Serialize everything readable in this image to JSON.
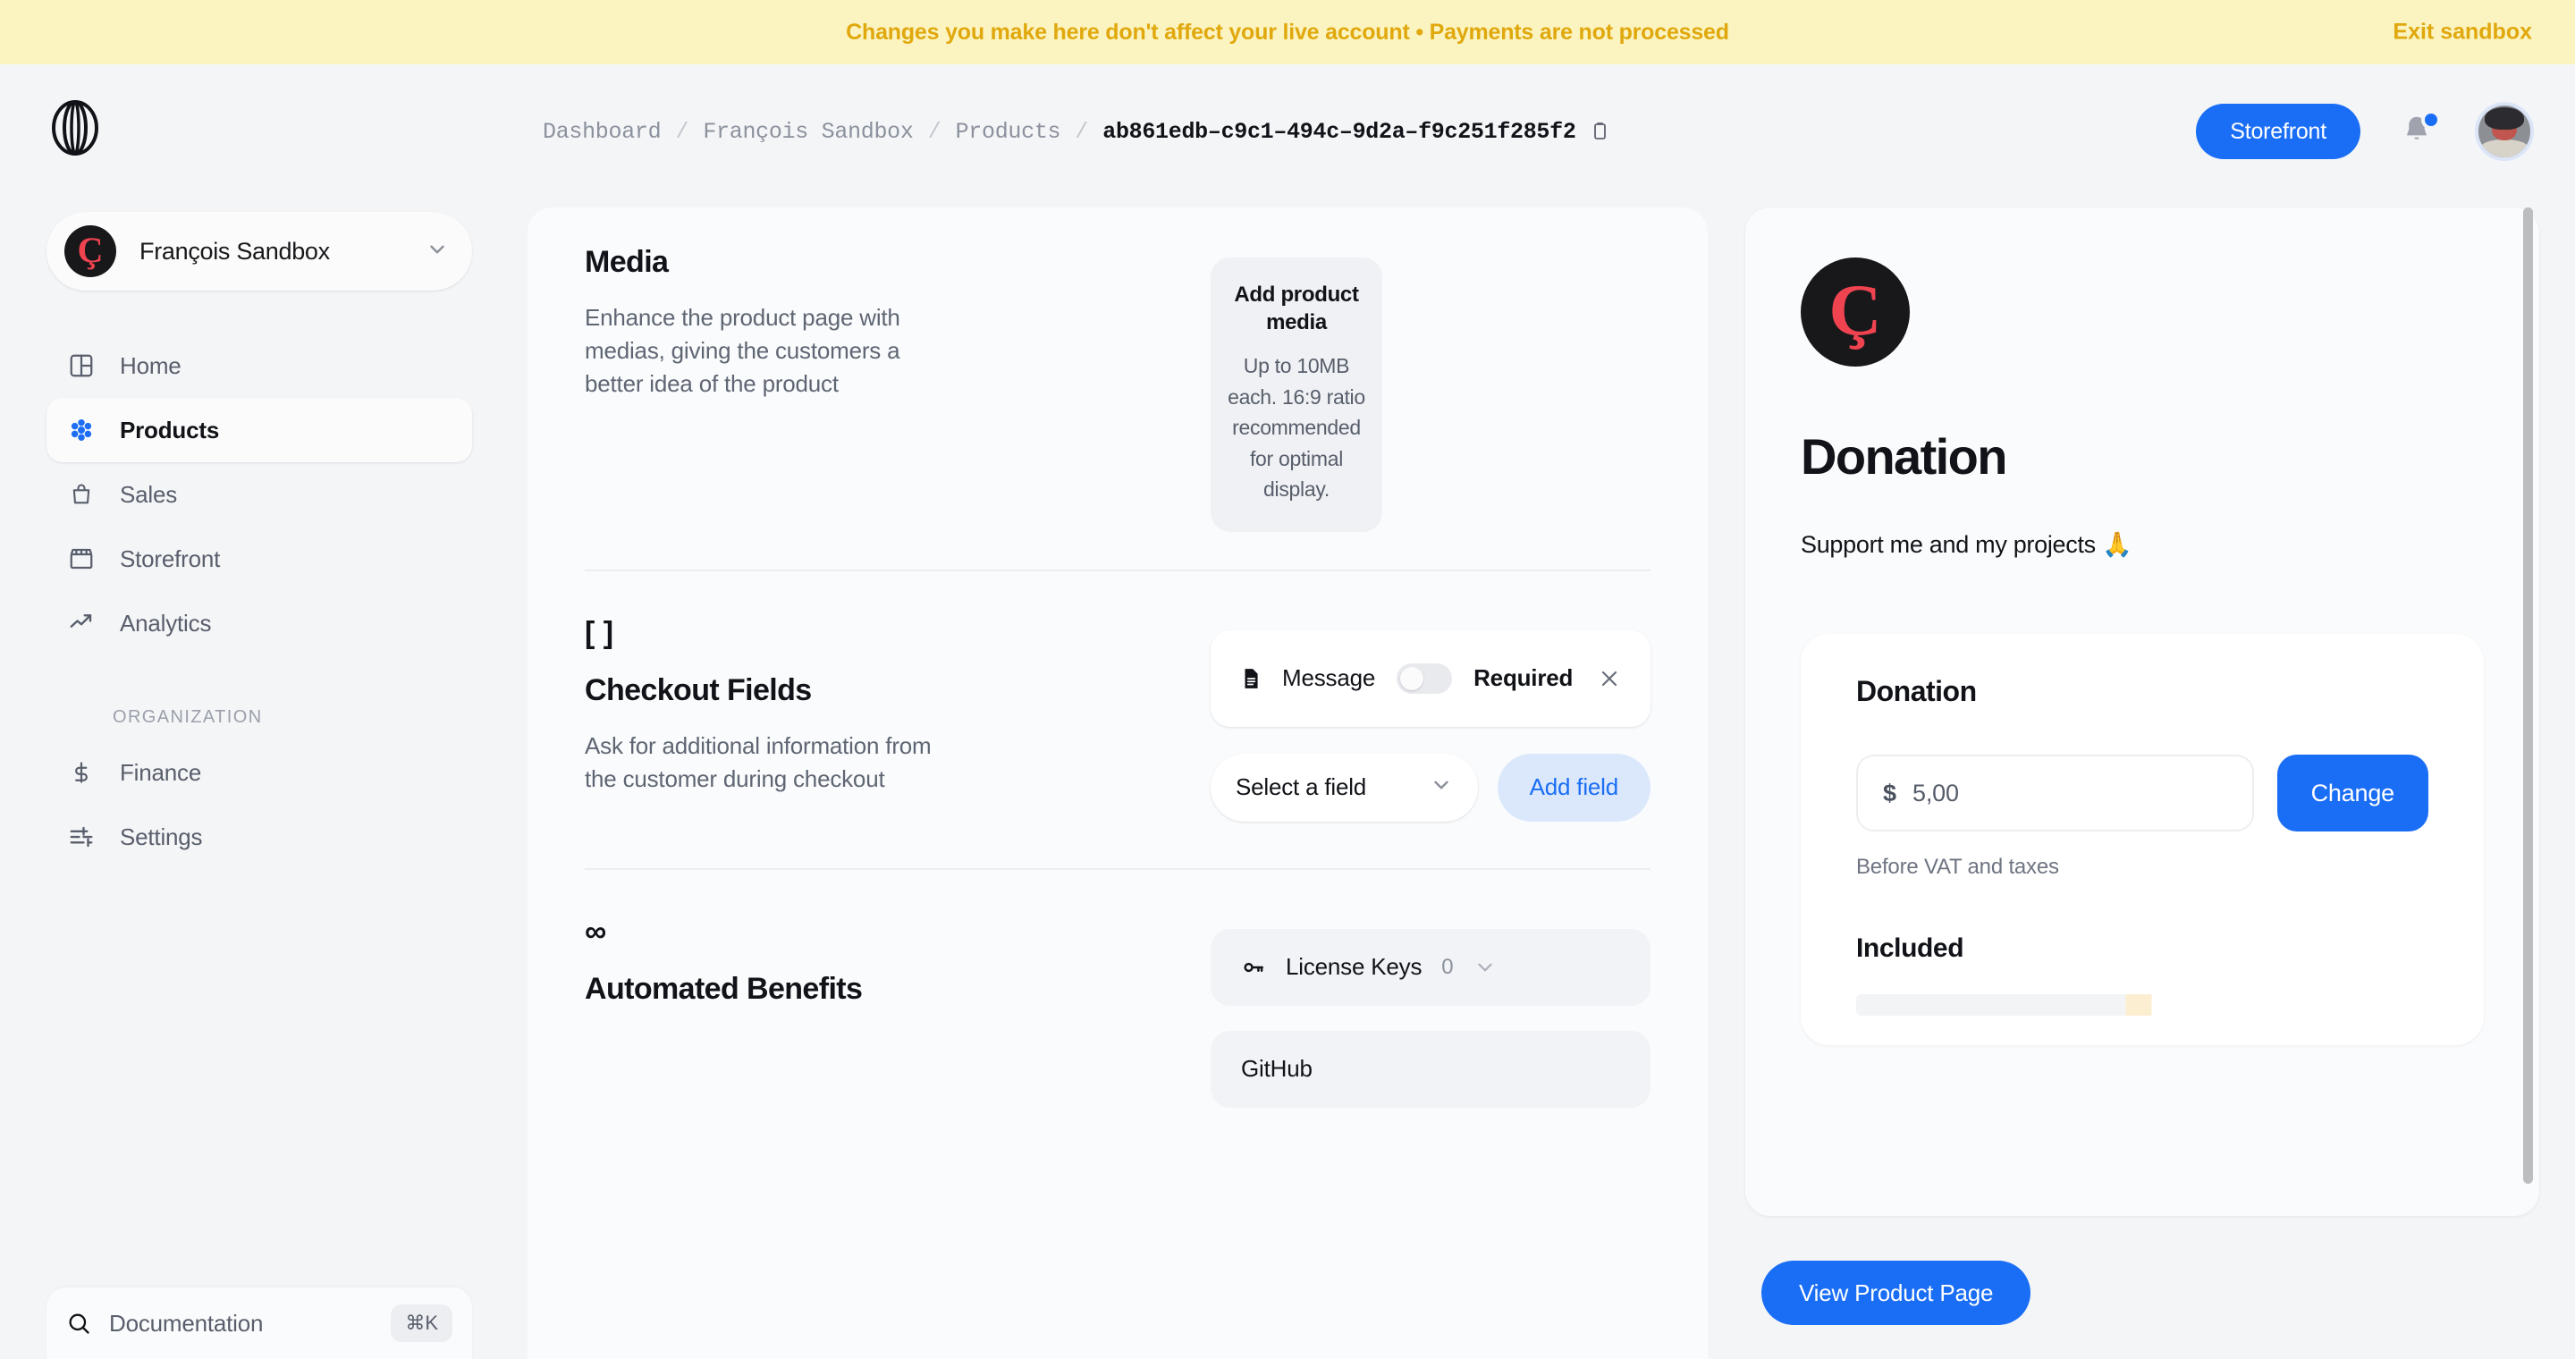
{
  "banner": {
    "message": "Changes you make here don't affect your live account • Payments are not processed",
    "exit_label": "Exit sandbox",
    "bg_color": "#fbf4c0",
    "text_color": "#e0a80d"
  },
  "sidebar": {
    "logo_name": "polar-logo",
    "org": {
      "name": "François Sandbox",
      "avatar_letter": "Ç"
    },
    "nav": [
      {
        "label": "Home",
        "icon": "layout-icon",
        "active": false
      },
      {
        "label": "Products",
        "icon": "flower-icon",
        "active": true
      },
      {
        "label": "Sales",
        "icon": "bag-icon",
        "active": false
      },
      {
        "label": "Storefront",
        "icon": "store-icon",
        "active": false
      },
      {
        "label": "Analytics",
        "icon": "trending-up-icon",
        "active": false
      }
    ],
    "group_label": "ORGANIZATION",
    "org_nav": [
      {
        "label": "Finance",
        "icon": "dollar-icon",
        "active": false
      },
      {
        "label": "Settings",
        "icon": "sliders-icon",
        "active": false
      }
    ],
    "documentation": {
      "label": "Documentation",
      "shortcut": "⌘K"
    }
  },
  "header": {
    "breadcrumb": [
      {
        "label": "Dashboard",
        "current": false
      },
      {
        "label": "François Sandbox",
        "current": false
      },
      {
        "label": "Products",
        "current": false
      },
      {
        "label": "ab861edb–c9c1–494c–9d2a–f9c251f285f2",
        "current": true
      }
    ],
    "separator": "/",
    "copy_icon": "clipboard-icon",
    "storefront_button": "Storefront",
    "notifications_icon": "bell-icon",
    "has_notification": true,
    "avatar_name": "user-avatar",
    "accent_color": "#1a6ef5"
  },
  "main": {
    "media": {
      "title": "Media",
      "description": "Enhance the product page with medias, giving the customers a better idea of the product",
      "dropzone_title": "Add product media",
      "dropzone_subtitle": "Up to 10MB each. 16:9 ratio recommended for optimal display."
    },
    "checkout_fields": {
      "icon_glyph": "[ ]",
      "title": "Checkout Fields",
      "description": "Ask for additional information from the customer during checkout",
      "fields": [
        {
          "name": "Message",
          "icon": "document-icon",
          "required_label": "Required",
          "required_on": false,
          "remove_icon": "close-icon"
        }
      ],
      "select_placeholder": "Select a field",
      "add_button": "Add field"
    },
    "automated_benefits": {
      "icon_glyph": "∞",
      "title": "Automated Benefits",
      "items": [
        {
          "label": "License Keys",
          "icon": "key-icon",
          "count": "0"
        },
        {
          "label": "GitHub",
          "icon": "github-icon",
          "count": ""
        }
      ]
    }
  },
  "preview": {
    "logo_letter": "Ç",
    "title": "Donation",
    "description": "Support me and my projects 🙏",
    "card": {
      "title": "Donation",
      "currency_symbol": "$",
      "amount": "5,00",
      "change_button": "Change",
      "vat_note": "Before VAT and taxes",
      "included_title": "Included"
    },
    "view_button": "View Product Page"
  }
}
